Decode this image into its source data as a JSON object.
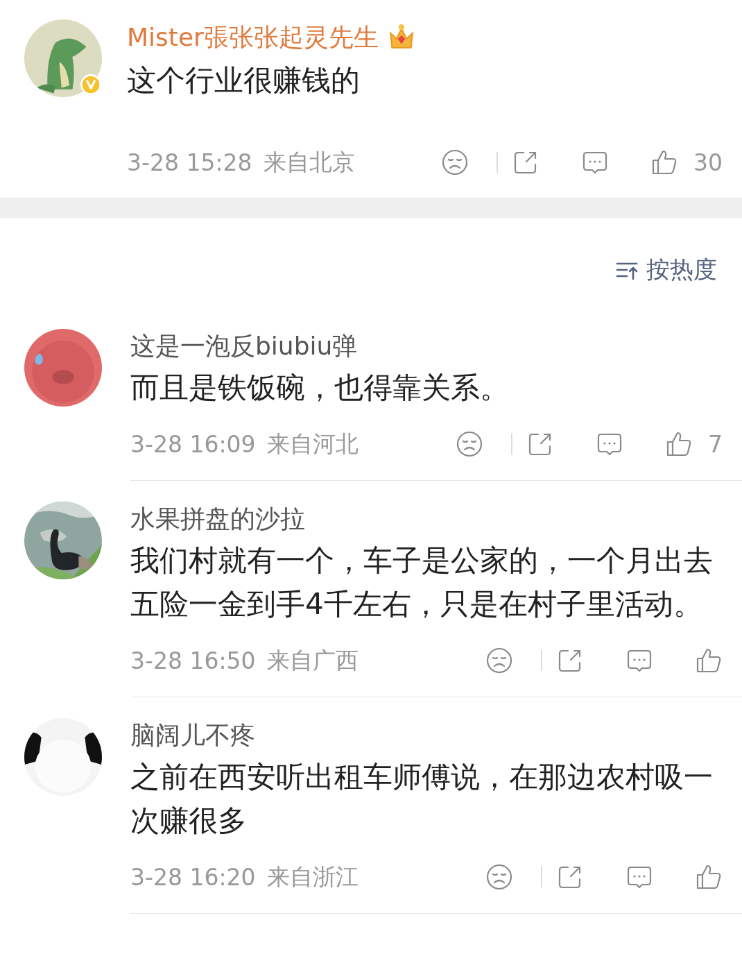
{
  "post": {
    "verified": true,
    "crown": true,
    "author": "Mister張张张起灵先生",
    "text": "这个行业很赚钱的",
    "time": "3-28 15:28",
    "location": "来自北京",
    "likes": "30"
  },
  "sort": {
    "label": "按热度"
  },
  "comments": [
    {
      "author": "这是一泡反biubiu弹",
      "text": "而且是铁饭碗，也得靠关系。",
      "time": "3-28 16:09",
      "location": "来自河北",
      "likes": "7"
    },
    {
      "author": "水果拼盘的沙拉",
      "text": "我们村就有一个，车子是公家的，一个月出去五险一金到手4千左右，只是在村子里活动。",
      "time": "3-28 16:50",
      "location": "来自广西"
    },
    {
      "author": "脑阔儿不疼",
      "text": "之前在西安听出租车师傅说，在那边农村吸一次赚很多",
      "time": "3-28 16:20",
      "location": "来自浙江"
    }
  ]
}
